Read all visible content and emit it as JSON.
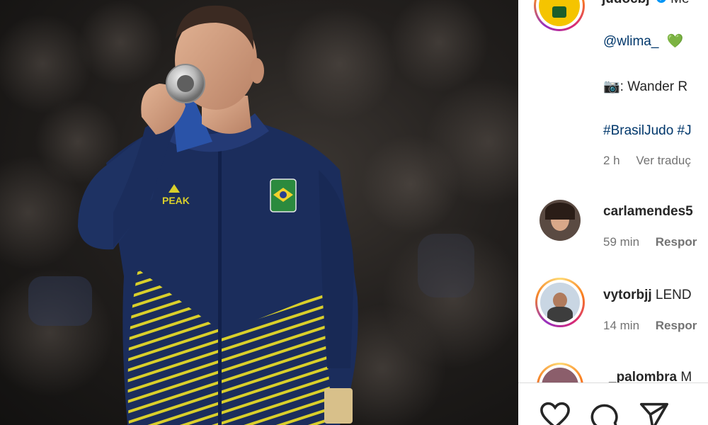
{
  "post": {
    "author": "judocbj",
    "caption_partial": "Me",
    "mention": "@wlima_",
    "emoji_heart": "💚",
    "camera_emoji": "📷",
    "photo_credit": ": Wander R",
    "hashtags": "#BrasilJudo #J",
    "time": "2 h",
    "translate": "Ver traduç"
  },
  "comments": [
    {
      "username": "carlamendes5",
      "text": "",
      "time": "59 min",
      "reply": "Respor"
    },
    {
      "username": "vytorbjj",
      "text": " LEND",
      "time": "14 min",
      "reply": "Respor"
    },
    {
      "username": "_palombra",
      "text": " M",
      "time": "",
      "reply": ""
    }
  ],
  "actions": {
    "like_icon": "heart-outline-icon",
    "comment_icon": "comment-bubble-icon",
    "share_icon": "paper-plane-icon"
  },
  "colors": {
    "jacket_navy": "#1b2d5c",
    "stripe_yellow": "#d9cf2b",
    "link_blue": "#00376b",
    "green_heart": "#1fad3b"
  }
}
